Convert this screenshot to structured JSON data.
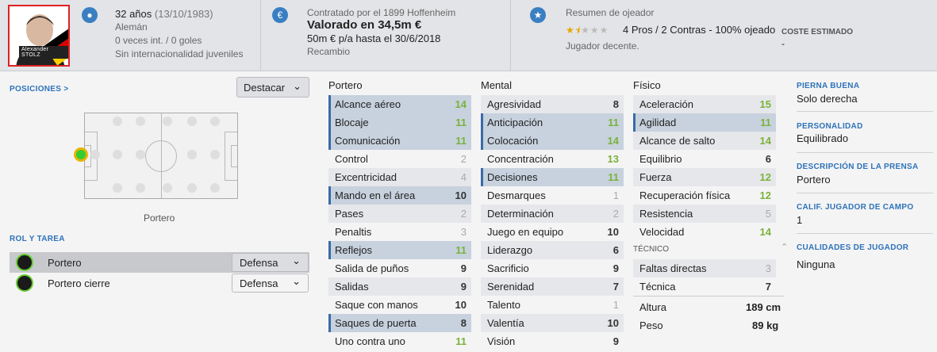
{
  "player": {
    "photo_name": "Alexander STOLZ",
    "age": "32 años",
    "dob": "(13/10/1983)",
    "nationality": "Alemán",
    "caps": "0 veces int. / 0 goles",
    "youth": "Sin internacionalidad juveniles"
  },
  "contract": {
    "label": "Contratado por el 1899 Hoffenheim",
    "value": "Valorado en 34,5m €",
    "wage": "50m € p/a hasta el 30/6/2018",
    "role": "Recambio"
  },
  "scout": {
    "label": "Resumen de ojeador",
    "summary": "4 Pros / 2 Contras - 100% ojeado",
    "desc": "Jugador decente.",
    "stars": 1.5,
    "cost_label": "COSTE ESTIMADO",
    "cost": "-"
  },
  "positions": {
    "label": "POSICIONES >",
    "highlight_btn": "Destacar",
    "current": "Portero"
  },
  "roles": {
    "label": "ROL Y TAREA",
    "items": [
      {
        "role": "Portero",
        "duty": "Defensa"
      },
      {
        "role": "Portero cierre",
        "duty": "Defensa"
      }
    ]
  },
  "attrs": {
    "portero": {
      "title": "Portero",
      "items": [
        [
          "Alcance aéreo",
          "14"
        ],
        [
          "Blocaje",
          "11"
        ],
        [
          "Comunicación",
          "11"
        ],
        [
          "Control",
          "2"
        ],
        [
          "Excentricidad",
          "4"
        ],
        [
          "Mando en el área",
          "10"
        ],
        [
          "Pases",
          "2"
        ],
        [
          "Penaltis",
          "3"
        ],
        [
          "Reflejos",
          "11"
        ],
        [
          "Salida de puños",
          "9"
        ],
        [
          "Salidas",
          "9"
        ],
        [
          "Saque con manos",
          "10"
        ],
        [
          "Saques de puerta",
          "8"
        ],
        [
          "Uno contra uno",
          "11"
        ]
      ]
    },
    "mental": {
      "title": "Mental",
      "items": [
        [
          "Agresividad",
          "8"
        ],
        [
          "Anticipación",
          "11"
        ],
        [
          "Colocación",
          "14"
        ],
        [
          "Concentración",
          "13"
        ],
        [
          "Decisiones",
          "11"
        ],
        [
          "Desmarques",
          "1"
        ],
        [
          "Determinación",
          "2"
        ],
        [
          "Juego en equipo",
          "10"
        ],
        [
          "Liderazgo",
          "6"
        ],
        [
          "Sacrificio",
          "9"
        ],
        [
          "Serenidad",
          "7"
        ],
        [
          "Talento",
          "1"
        ],
        [
          "Valentía",
          "10"
        ],
        [
          "Visión",
          "9"
        ]
      ]
    },
    "fisico": {
      "title": "Físico",
      "items": [
        [
          "Aceleración",
          "15"
        ],
        [
          "Agilidad",
          "11"
        ],
        [
          "Alcance de salto",
          "14"
        ],
        [
          "Equilibrio",
          "6"
        ],
        [
          "Fuerza",
          "12"
        ],
        [
          "Recuperación física",
          "12"
        ],
        [
          "Resistencia",
          "5"
        ],
        [
          "Velocidad",
          "14"
        ]
      ]
    },
    "tecnico": {
      "title": "TÉCNICO",
      "items": [
        [
          "Faltas directas",
          "3"
        ],
        [
          "Técnica",
          "7"
        ]
      ]
    }
  },
  "physical": {
    "height_label": "Altura",
    "height": "189 cm",
    "weight_label": "Peso",
    "weight": "89 kg"
  },
  "right": {
    "foot_label": "PIERNA BUENA",
    "foot": "Solo derecha",
    "pers_label": "PERSONALIDAD",
    "pers": "Equilibrado",
    "press_label": "DESCRIPCIÓN DE LA PRENSA",
    "press": "Portero",
    "calif_label": "CALIF. JUGADOR DE CAMPO",
    "calif": "1",
    "qual_label": "CUALIDADES DE JUGADOR",
    "qual": "Ninguna"
  }
}
